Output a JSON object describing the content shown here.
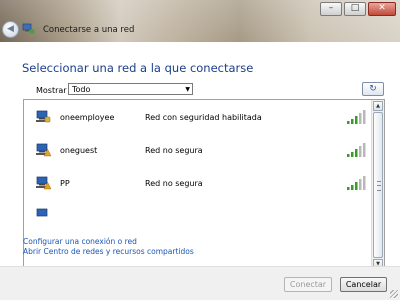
{
  "window": {
    "title": "Conectarse a una red",
    "minimize_glyph": "–",
    "maximize_glyph": "□",
    "close_glyph": "✕",
    "back_glyph": "◀"
  },
  "main": {
    "heading": "Seleccionar una red a la que conectarse",
    "filter_label": "Mostrar",
    "filter_value": "Todo",
    "refresh_glyph": "↻"
  },
  "networks": [
    {
      "name": "oneemployee",
      "status": "Red con seguridad habilitada",
      "secured": true,
      "signal_bars": 5
    },
    {
      "name": "oneguest",
      "status": "Red no segura",
      "secured": false,
      "signal_bars": 5
    },
    {
      "name": "PP",
      "status": "Red no segura",
      "secured": false,
      "signal_bars": 5
    },
    {
      "name": "",
      "status": "",
      "secured": false,
      "signal_bars": 0
    }
  ],
  "links": {
    "setup_connection": "Configurar una conexión o red",
    "network_center": "Abrir Centro de redes y recursos compartidos"
  },
  "footer": {
    "connect_label": "Conectar",
    "cancel_label": "Cancelar"
  },
  "colors": {
    "heading": "#1a3f8c",
    "link": "#1a55b4",
    "signal_green": "#3a9a2a",
    "warning_orange": "#e8a020"
  }
}
